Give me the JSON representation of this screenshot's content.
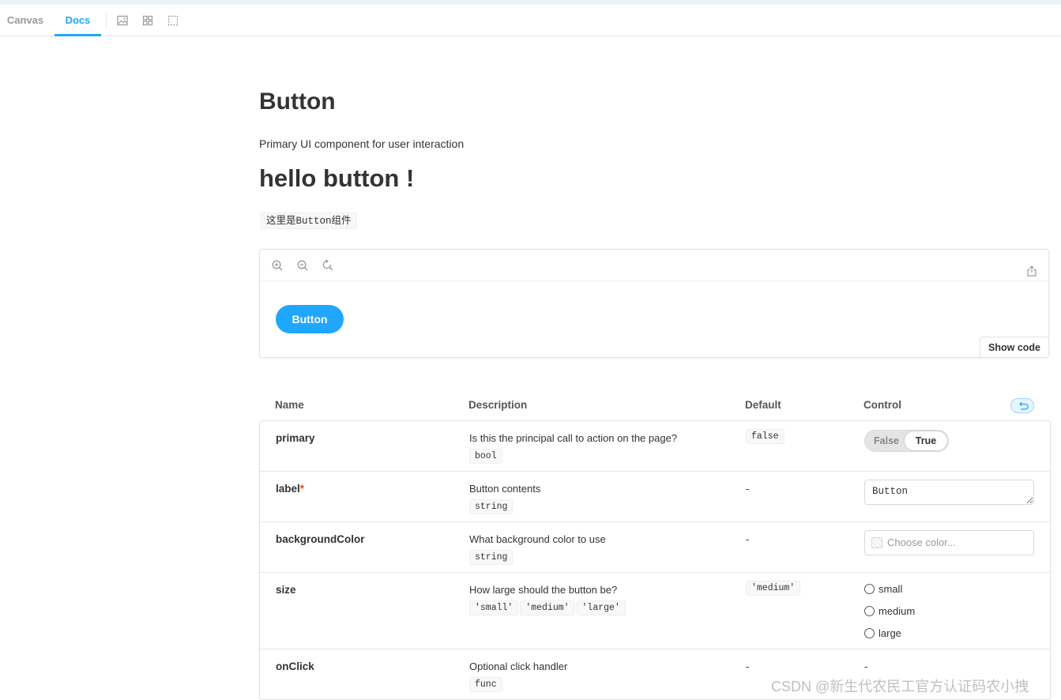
{
  "toolbar": {
    "tabs": [
      {
        "label": "Canvas",
        "active": false
      },
      {
        "label": "Docs",
        "active": true
      }
    ],
    "icons": [
      "image-icon",
      "grid-icon",
      "outline-icon"
    ],
    "accent_color": "#1ea7fd"
  },
  "doc": {
    "title": "Button",
    "subtitle": "Primary UI component for user interaction",
    "heading": "hello button !",
    "code_note": "这里是Button组件"
  },
  "preview": {
    "icons": [
      "zoom-in-icon",
      "zoom-out-icon",
      "reset-zoom-icon",
      "share-icon"
    ],
    "button_label": "Button",
    "show_code_label": "Show code"
  },
  "args_table": {
    "headers": {
      "name": "Name",
      "description": "Description",
      "default": "Default",
      "control": "Control"
    },
    "rows": [
      {
        "name": "primary",
        "required": false,
        "description": "Is this the principal call to action on the page?",
        "type_chips": [
          "bool"
        ],
        "default": "false",
        "control": {
          "type": "toggle",
          "options": [
            "False",
            "True"
          ],
          "selected": "True"
        }
      },
      {
        "name": "label",
        "required": true,
        "required_mark": "*",
        "description": "Button contents",
        "type_chips": [
          "string"
        ],
        "default": "-",
        "control": {
          "type": "text",
          "value": "Button"
        }
      },
      {
        "name": "backgroundColor",
        "required": false,
        "description": "What background color to use",
        "type_chips": [
          "string"
        ],
        "default": "-",
        "control": {
          "type": "color",
          "placeholder": "Choose color..."
        }
      },
      {
        "name": "size",
        "required": false,
        "description": "How large should the button be?",
        "type_chips": [
          "'small'",
          "'medium'",
          "'large'"
        ],
        "default": "'medium'",
        "control": {
          "type": "radio",
          "options": [
            "small",
            "medium",
            "large"
          ],
          "selected": null
        }
      },
      {
        "name": "onClick",
        "required": false,
        "description": "Optional click handler",
        "type_chips": [
          "func"
        ],
        "default": "-",
        "control": {
          "type": "none",
          "value": "-"
        }
      }
    ]
  },
  "watermark": "CSDN @新生代农民工官方认证码农小拽"
}
